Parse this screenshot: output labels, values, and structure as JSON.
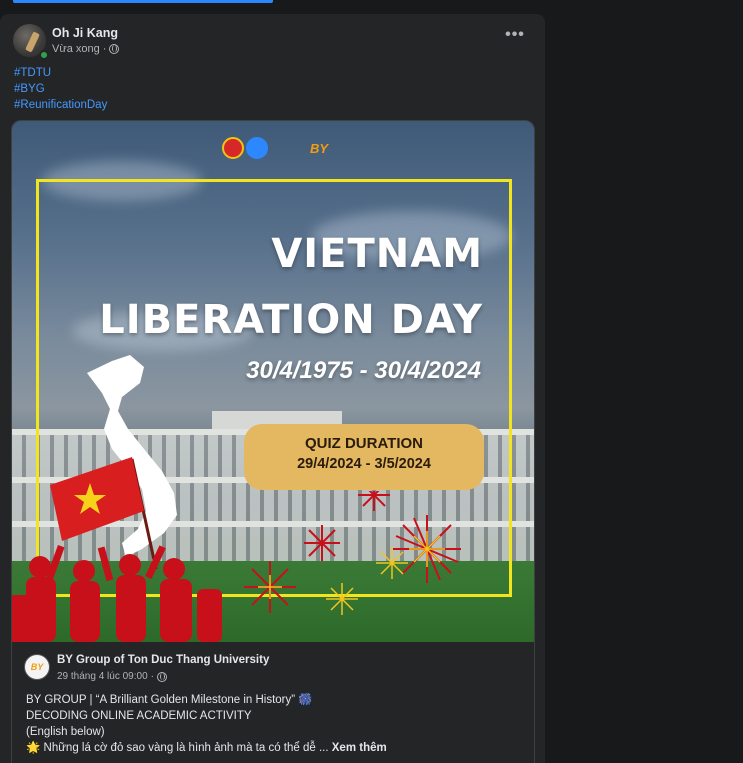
{
  "post": {
    "author": "Oh Ji Kang",
    "time": "Vừa xong",
    "separator": "·",
    "more_label": "•••",
    "hashtags": [
      "#TDTU",
      "#BYG",
      "#ReunificationDay"
    ]
  },
  "banner": {
    "logo_text": "BY",
    "title_line1": "VIETNAM",
    "title_line2": "LIBERATION DAY",
    "date_range": "30/4/1975 - 30/4/2024",
    "quiz_title": "QUIZ DURATION",
    "quiz_dates": "29/4/2024 - 3/5/2024"
  },
  "shared_post": {
    "page_name": "BY Group of Ton Duc Thang University",
    "avatar_text": "BY",
    "timestamp": "29 tháng 4 lúc 09:00",
    "separator": "·",
    "line1": "BY GROUP | “A Brilliant Golden Milestone in History”",
    "line1_emoji": "🎆",
    "line2": "DECODING ONLINE ACADEMIC ACTIVITY",
    "line3": "(English below)",
    "line4_emoji": "🌟",
    "line4": "Những lá cờ đỏ sao vàng là hình ảnh mà  ta có thể dễ ...",
    "see_more": "Xem thêm"
  },
  "colors": {
    "accent": "#2d88ff",
    "link": "#4599ff",
    "frame": "#f2e51d",
    "quiz_box": "#e3b861",
    "flag_red": "#d81e1e",
    "star_yellow": "#f7d21a"
  }
}
